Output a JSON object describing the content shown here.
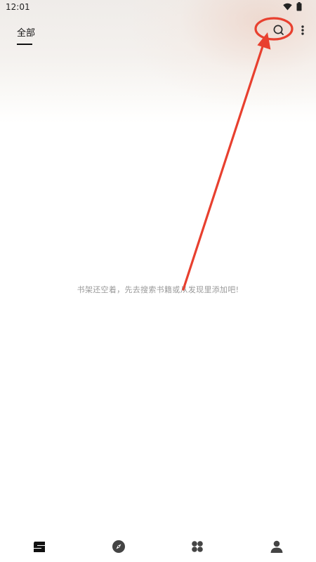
{
  "status_bar": {
    "time": "12:01",
    "icons": [
      "wifi-icon",
      "battery-icon"
    ]
  },
  "header": {
    "tabs": [
      {
        "label": "全部",
        "active": true
      }
    ],
    "actions": [
      "search-icon",
      "more-vert-icon"
    ]
  },
  "bookshelf": {
    "empty_hint": "书架还空着，先去搜索书籍或从发现里添加吧!"
  },
  "annotation": {
    "color": "#e8402f",
    "target": "search-button"
  },
  "bottom_nav": {
    "items": [
      {
        "icon": "bookshelf-icon",
        "active": true
      },
      {
        "icon": "compass-icon",
        "active": false
      },
      {
        "icon": "grid-apps-icon",
        "active": false
      },
      {
        "icon": "person-icon",
        "active": false
      }
    ]
  },
  "colors": {
    "primary_text": "#111111",
    "hint_text": "#9a9a9a",
    "icon": "#2b2b2b",
    "background": "#ffffff"
  }
}
